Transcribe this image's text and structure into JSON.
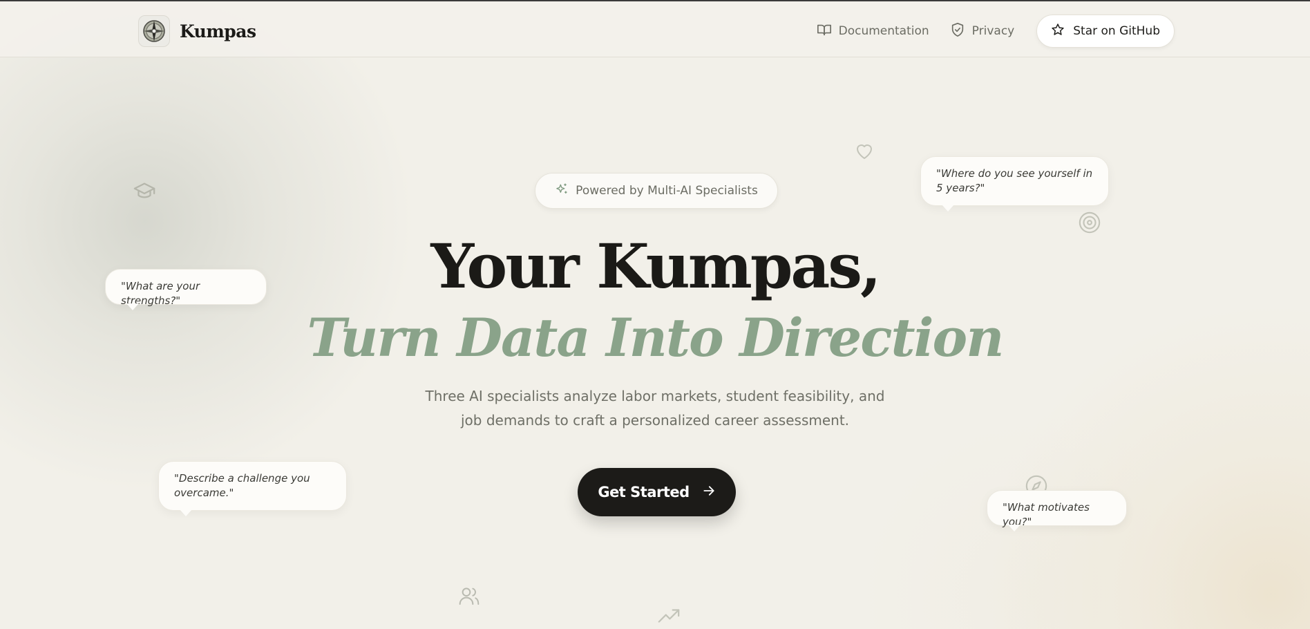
{
  "brand": {
    "name": "Kumpas",
    "logo_icon": "compass-icon"
  },
  "nav": {
    "documentation": "Documentation",
    "documentation_icon": "book-icon",
    "privacy": "Privacy",
    "privacy_icon": "shield-check-icon",
    "github": "Star on GitHub",
    "github_icon": "star-icon"
  },
  "hero": {
    "badge": "Powered by Multi-AI Specialists",
    "badge_icon": "sparkles-icon",
    "title": "Your Kumpas,",
    "subtitle": "Turn Data Into Direction",
    "description": "Three AI specialists analyze labor markets, student feasibility, and job demands to craft a personalized career assessment.",
    "cta": "Get Started",
    "cta_icon": "arrow-right-icon"
  },
  "bubbles": [
    "\"What are your strengths?\"",
    "\"Describe a challenge you overcame.\"",
    "\"Where do you see yourself in 5 years?\"",
    "\"What motivates you?\""
  ],
  "decorations": [
    "graduation-cap-icon",
    "heart-icon",
    "target-icon",
    "compass-icon",
    "users-icon",
    "trending-up-icon"
  ],
  "colors": {
    "background": "#f2f0e9",
    "accent_green": "#8aa38a",
    "cta_dark": "#1c1b18",
    "text_muted": "#6e6f66"
  }
}
